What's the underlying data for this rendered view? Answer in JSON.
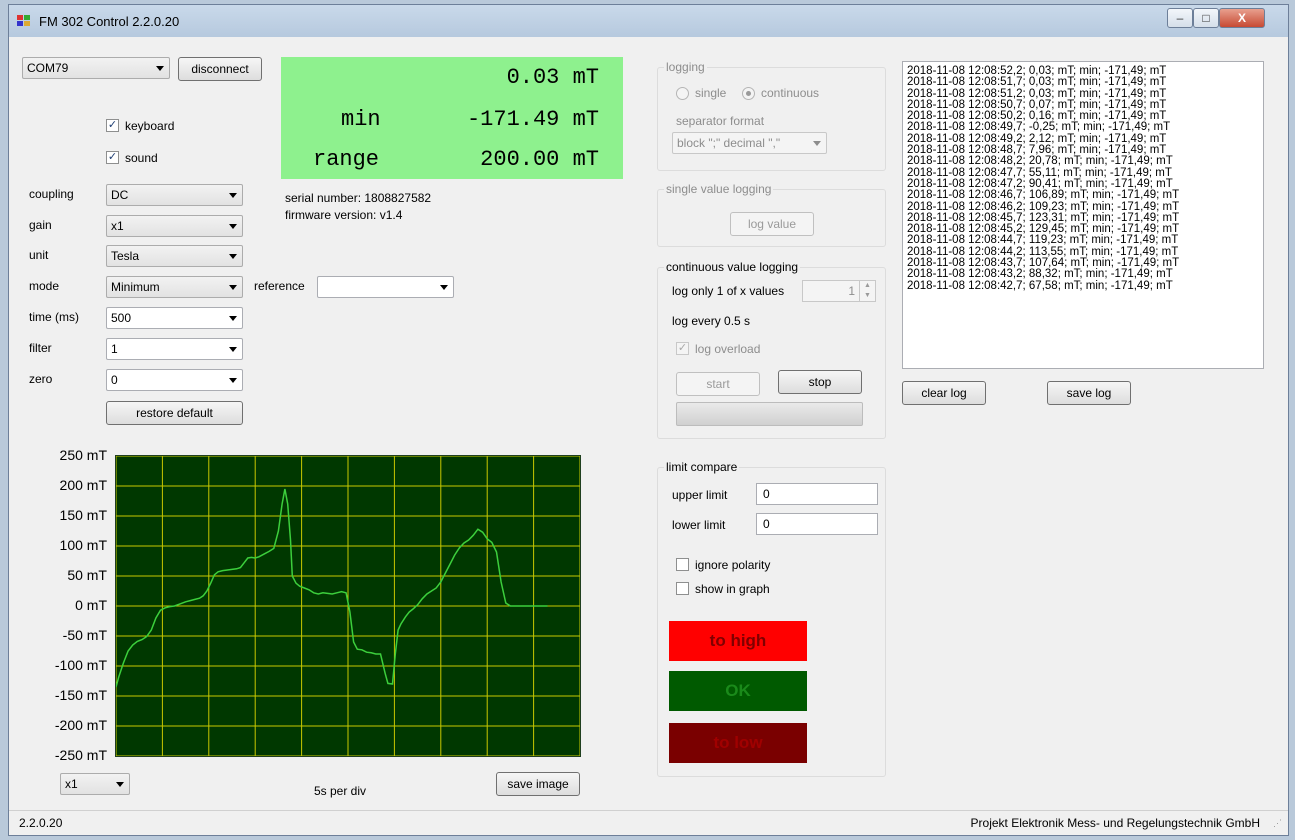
{
  "window": {
    "title": "FM 302 Control 2.2.0.20",
    "minimize": "–",
    "maximize": "□",
    "close": "X"
  },
  "port": {
    "value": "COM79",
    "disconnect_label": "disconnect"
  },
  "options": {
    "keyboard_label": "keyboard",
    "keyboard_checked": true,
    "sound_label": "sound",
    "sound_checked": true
  },
  "settings": [
    {
      "label": "coupling",
      "value": "DC"
    },
    {
      "label": "gain",
      "value": "x1"
    },
    {
      "label": "unit",
      "value": "Tesla"
    },
    {
      "label": "mode",
      "value": "Minimum"
    },
    {
      "label": "time (ms)",
      "value": "500"
    },
    {
      "label": "filter",
      "value": "1"
    },
    {
      "label": "zero",
      "value": "0"
    }
  ],
  "reference": {
    "label": "reference",
    "value": ""
  },
  "restore_default_label": "restore default",
  "display": {
    "value": "0.03 mT",
    "min_label": "min",
    "min_value": "-171.49 mT",
    "range_label": "range",
    "range_value": "200.00 mT",
    "color": "#8ef18e"
  },
  "device": {
    "serial": "serial number: 1808827582",
    "firmware": "firmware version: v1.4"
  },
  "logging": {
    "title": "logging",
    "single": "single",
    "continuous": "continuous",
    "selected": "continuous",
    "separator_label": "separator format",
    "separator_value": "block \";\" decimal \",\""
  },
  "single_logging": {
    "title": "single value logging",
    "button": "log value"
  },
  "continuous_logging": {
    "title": "continuous value logging",
    "log_only_label": "log only 1 of x values",
    "log_only_value": "1",
    "log_every": "log every 0.5 s",
    "log_overload_label": "log overload",
    "log_overload_checked": true,
    "start_label": "start",
    "stop_label": "stop"
  },
  "limit": {
    "title": "limit compare",
    "upper_label": "upper limit",
    "upper_value": "0",
    "lower_label": "lower limit",
    "lower_value": "0",
    "ignore_polarity": "ignore polarity",
    "show_in_graph": "show in graph",
    "to_high": "to high",
    "ok": "OK",
    "to_low": "to low",
    "colors": {
      "high": "#ff0000",
      "ok": "#005a00",
      "low": "#7a0000"
    }
  },
  "log_lines": [
    "2018-11-08 12:08:52,2; 0,03; mT; min; -171,49; mT",
    "2018-11-08 12:08:51,7; 0,03; mT; min; -171,49; mT",
    "2018-11-08 12:08:51,2; 0,03; mT; min; -171,49; mT",
    "2018-11-08 12:08:50,7; 0,07; mT; min; -171,49; mT",
    "2018-11-08 12:08:50,2; 0,16; mT; min; -171,49; mT",
    "2018-11-08 12:08:49,7; -0,25; mT; min; -171,49; mT",
    "2018-11-08 12:08:49,2; 2,12; mT; min; -171,49; mT",
    "2018-11-08 12:08:48,7; 7,96; mT; min; -171,49; mT",
    "2018-11-08 12:08:48,2; 20,78; mT; min; -171,49; mT",
    "2018-11-08 12:08:47,7; 55,11; mT; min; -171,49; mT",
    "2018-11-08 12:08:47,2; 90,41; mT; min; -171,49; mT",
    "2018-11-08 12:08:46,7; 106,89; mT; min; -171,49; mT",
    "2018-11-08 12:08:46,2; 109,23; mT; min; -171,49; mT",
    "2018-11-08 12:08:45,7; 123,31; mT; min; -171,49; mT",
    "2018-11-08 12:08:45,2; 129,45; mT; min; -171,49; mT",
    "2018-11-08 12:08:44,7; 119,23; mT; min; -171,49; mT",
    "2018-11-08 12:08:44,2; 113,55; mT; min; -171,49; mT",
    "2018-11-08 12:08:43,7; 107,64; mT; min; -171,49; mT",
    "2018-11-08 12:08:43,2; 88,32; mT; min; -171,49; mT",
    "2018-11-08 12:08:42,7; 67,58; mT; min; -171,49; mT"
  ],
  "log_buttons": {
    "clear": "clear log",
    "save": "save log"
  },
  "graph": {
    "zoom_value": "x1",
    "time_per_div": "5s per div",
    "save_image_label": "save image",
    "y_ticks": [
      "250 mT",
      "200 mT",
      "150 mT",
      "100 mT",
      "50 mT",
      "0 mT",
      "-50 mT",
      "-100 mT",
      "-150 mT",
      "-200 mT",
      "-250 mT"
    ],
    "grid_color": "#c8c800",
    "trace_color": "#3ccf3c",
    "background_color": "#003800"
  },
  "chart_data": {
    "type": "line",
    "ylim": [
      -250,
      250
    ],
    "xlim": [
      0,
      50
    ],
    "ylabel": "",
    "xlabel": "",
    "series": [
      {
        "values": [
          [
            0,
            -135
          ],
          [
            0.3,
            -118
          ],
          [
            0.8,
            -95
          ],
          [
            1.3,
            -75
          ],
          [
            1.8,
            -65
          ],
          [
            2.3,
            -59
          ],
          [
            2.8,
            -56
          ],
          [
            3.3,
            -51
          ],
          [
            3.8,
            -40
          ],
          [
            4.3,
            -20
          ],
          [
            4.8,
            -7
          ],
          [
            5.3,
            -3
          ],
          [
            5.8,
            -1
          ],
          [
            6.3,
            0
          ],
          [
            7,
            4
          ],
          [
            7.5,
            7
          ],
          [
            8,
            9
          ],
          [
            8.5,
            11
          ],
          [
            9,
            13
          ],
          [
            9.4,
            17
          ],
          [
            9.8,
            25
          ],
          [
            10.2,
            38
          ],
          [
            10.6,
            52
          ],
          [
            11,
            57
          ],
          [
            11.5,
            59
          ],
          [
            12,
            60
          ],
          [
            12.5,
            61
          ],
          [
            13,
            62
          ],
          [
            13.4,
            64
          ],
          [
            13.8,
            72
          ],
          [
            14.2,
            80
          ],
          [
            14.6,
            81
          ],
          [
            15,
            80
          ],
          [
            15.4,
            82
          ],
          [
            16,
            87
          ],
          [
            16.5,
            91
          ],
          [
            17,
            96
          ],
          [
            17.5,
            125
          ],
          [
            17.9,
            170
          ],
          [
            18.2,
            195
          ],
          [
            18.5,
            170
          ],
          [
            18.8,
            110
          ],
          [
            19,
            50
          ],
          [
            19.4,
            38
          ],
          [
            19.8,
            33
          ],
          [
            20.3,
            30
          ],
          [
            20.8,
            27
          ],
          [
            21.3,
            22
          ],
          [
            21.8,
            20
          ],
          [
            22.3,
            22
          ],
          [
            22.8,
            21
          ],
          [
            23.3,
            20
          ],
          [
            23.8,
            22
          ],
          [
            24.3,
            24
          ],
          [
            24.8,
            22
          ],
          [
            25.2,
            -10
          ],
          [
            25.6,
            -60
          ],
          [
            26,
            -72
          ],
          [
            26.5,
            -73
          ],
          [
            27,
            -77
          ],
          [
            27.5,
            -78
          ],
          [
            28,
            -80
          ],
          [
            28.5,
            -80
          ],
          [
            29,
            -112
          ],
          [
            29.3,
            -129
          ],
          [
            29.8,
            -130
          ],
          [
            30.1,
            -80
          ],
          [
            30.4,
            -40
          ],
          [
            30.7,
            -30
          ],
          [
            31.2,
            -18
          ],
          [
            31.6,
            -10
          ],
          [
            32,
            -5
          ],
          [
            32.5,
            2
          ],
          [
            33,
            12
          ],
          [
            33.5,
            20
          ],
          [
            34,
            25
          ],
          [
            34.5,
            30
          ],
          [
            35,
            40
          ],
          [
            35.5,
            55
          ],
          [
            36,
            70
          ],
          [
            36.5,
            85
          ],
          [
            37,
            97
          ],
          [
            37.5,
            105
          ],
          [
            38,
            110
          ],
          [
            38.5,
            118
          ],
          [
            39,
            128
          ],
          [
            39.5,
            123
          ],
          [
            40,
            112
          ],
          [
            40.5,
            106
          ],
          [
            41,
            90
          ],
          [
            41.5,
            40
          ],
          [
            42,
            5
          ],
          [
            42.5,
            0
          ],
          [
            43,
            0
          ],
          [
            43.5,
            0
          ],
          [
            44,
            0
          ],
          [
            44.5,
            0
          ],
          [
            45,
            0
          ],
          [
            45.5,
            0
          ],
          [
            46,
            0
          ],
          [
            46.5,
            0
          ]
        ]
      }
    ]
  },
  "status_bar": {
    "version": "2.2.0.20",
    "company": "Projekt Elektronik Mess- und Regelungstechnik GmbH"
  }
}
